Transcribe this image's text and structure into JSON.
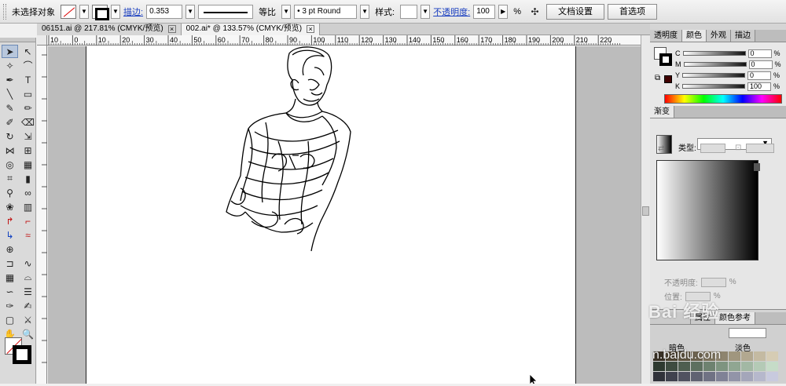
{
  "control_bar": {
    "selection_status": "未选择对象",
    "stroke_label": "描边:",
    "stroke_weight": "0.353",
    "profile_label": "等比",
    "brush_label": "3 pt Round",
    "style_label": "样式:",
    "opacity_label": "不透明度:",
    "opacity_value": "100",
    "opacity_unit": "%",
    "doc_setup_button": "文档设置",
    "prefs_button": "首选项"
  },
  "tabs": [
    {
      "label": "06151.ai @ 217.81% (CMYK/预览)"
    },
    {
      "label": "002.ai* @ 133.57% (CMYK/预览)"
    }
  ],
  "rulers": {
    "h_ticks": [
      "10",
      "0",
      "10",
      "20",
      "30",
      "40",
      "50",
      "60",
      "70",
      "80",
      "90",
      "100",
      "110",
      "120",
      "130",
      "140",
      "150",
      "160",
      "170",
      "180",
      "190",
      "200",
      "210",
      "220"
    ]
  },
  "color_panel": {
    "tabs": [
      "透明度",
      "颜色",
      "外观",
      "描边"
    ],
    "channels": [
      {
        "name": "C",
        "value": "0"
      },
      {
        "name": "M",
        "value": "0"
      },
      {
        "name": "Y",
        "value": "0"
      },
      {
        "name": "K",
        "value": "100"
      }
    ],
    "unit": "%"
  },
  "gradient_panel": {
    "title": "渐变",
    "type_label": "类型:",
    "opacity_label": "不透明度:",
    "location_label": "位置:",
    "unit": "%"
  },
  "swatch_panel": {
    "tabs": [
      "",
      "属性",
      "颜色参考"
    ],
    "label_left": "暗色",
    "label_right": "淡色",
    "colors": [
      "#3a3226",
      "#4e4432",
      "#5e5440",
      "#6e6450",
      "#7e745e",
      "#8e846e",
      "#a0967e",
      "#b2a890",
      "#c4baa2",
      "#d6ccb4",
      "#2e3a30",
      "#3e4c40",
      "#4e5e50",
      "#5e7060",
      "#6e8270",
      "#7e9480",
      "#90a692",
      "#a2b8a4",
      "#b4cab6",
      "#c6dcc8",
      "#30323a",
      "#40424e",
      "#505260",
      "#606272",
      "#707284",
      "#808296",
      "#9294a8",
      "#a4a6ba",
      "#b6b8cc",
      "#c8cade"
    ]
  },
  "watermark": {
    "line1": "Bai 经验",
    "line2": "n.baidu.com"
  }
}
